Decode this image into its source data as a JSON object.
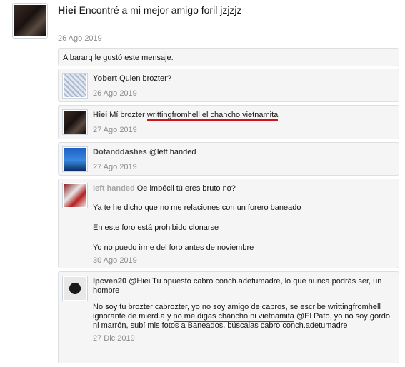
{
  "main_post": {
    "username": "Hiei",
    "message": "Encontré a mi mejor amigo foril jzjzjz",
    "date": "26 Ago 2019"
  },
  "likes": {
    "text": "A bararq le gustó este mensaje."
  },
  "comments": [
    {
      "username": "Yobert",
      "text": "Quien brozter?",
      "date": "26 Ago 2019"
    },
    {
      "username": "Hiei",
      "text_before": "Mí brozter ",
      "text_highlight": "writtingfromhell el chancho vietnamita",
      "date": "27 Ago 2019"
    },
    {
      "username": "Dotanddashes",
      "text": "@left handed",
      "date": "27 Ago 2019"
    },
    {
      "username": "left handed",
      "text": "Oe imbécil tú eres bruto no?",
      "para1": "Ya te he dicho que no me relaciones con un forero baneado",
      "para2": "En este foro está prohibido clonarse",
      "para3": "Yo no puedo irme del foro antes de noviembre",
      "date": "30 Ago 2019"
    },
    {
      "username": "lpcven20",
      "text": "@Hiei Tu opuesto cabro conch.adetumadre, lo que nunca podrás ser, un hombre",
      "para_before": "No soy tu brozter cabrozter, yo no soy amigo de cabros, se escribe writtingfromhell ignorante de mierd.a y ",
      "para_highlight": "no me digas chancho ni vietnamita",
      "para_after": " @El Pato, yo no soy gordo ni marrón, subí mis fotos a Baneados, búscalas cabro conch.adetumadre",
      "date": "27 Dic 2019"
    }
  ],
  "colors": {
    "highlight_underline": "#d4121a",
    "date": "#8c8c8c",
    "comment_bg": "#f5f5f5"
  }
}
